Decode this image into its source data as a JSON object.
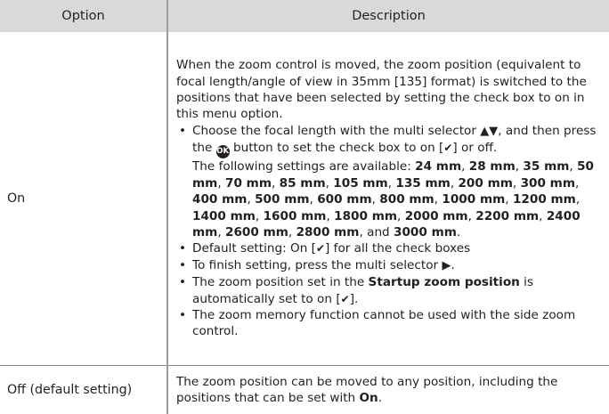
{
  "header": {
    "option": "Option",
    "description": "Description"
  },
  "row_on": {
    "option": "On",
    "intro": "When the zoom control is moved, the zoom position (equivalent to focal length/angle of view in 35mm [135] format) is switched to the positions that have been selected by setting the check box to on in this menu option.",
    "b1_a": "Choose the focal length with the multi selector ",
    "b1_arrows": "▲▼",
    "b1_b": ", and then press the ",
    "b1_ok": "OK",
    "b1_c": " button to set the check box to on [",
    "b1_check": "✔",
    "b1_d": "] or off.",
    "b1_e": "The following settings are available: ",
    "settings": [
      "24 mm",
      "28 mm",
      "35 mm",
      "50 mm",
      "70 mm",
      "85 mm",
      "105 mm",
      "135 mm",
      "200 mm",
      "300 mm",
      "400 mm",
      "500 mm",
      "600 mm",
      "800 mm",
      "1000 mm",
      "1200 mm",
      "1400 mm",
      "1600 mm",
      "1800 mm",
      "2000 mm",
      "2200 mm",
      "2400 mm",
      "2600 mm",
      "2800 mm",
      "3000 mm"
    ],
    "settings_sep": ", ",
    "settings_and": ", and ",
    "settings_end": ".",
    "b2_a": "Default setting: On [",
    "b2_check": "✔",
    "b2_b": "] for all the check boxes",
    "b3_a": "To finish setting, press the multi selector ",
    "b3_arrow": "▶",
    "b3_b": ".",
    "b4_a": "The zoom position set in the ",
    "b4_bold": "Startup zoom position",
    "b4_b": " is automatically set to on [",
    "b4_check": "✔",
    "b4_c": "].",
    "b5": "The zoom memory function cannot be used with the side zoom control."
  },
  "row_off": {
    "option": "Off (default setting)",
    "text_a": "The zoom position can be moved to any position, including the positions that can be set with ",
    "text_bold": "On",
    "text_b": "."
  }
}
